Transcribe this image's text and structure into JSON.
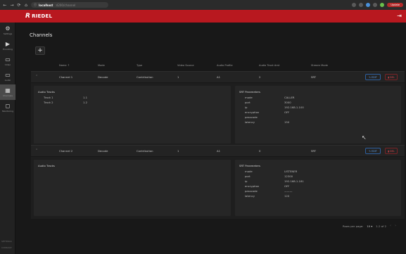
{
  "browser": {
    "nav": [
      "←",
      "→",
      "⟳",
      "⌂"
    ],
    "url_host": "localhost",
    "url_path": ":4200/channel",
    "profile": "Update"
  },
  "app": {
    "brand": "RIEDEL",
    "brand_mark": "R"
  },
  "sidebar": {
    "items": [
      {
        "icon": "⚙",
        "label": "Settings",
        "name": "settings"
      },
      {
        "icon": "▶",
        "label": "Encoding",
        "name": "encoding"
      },
      {
        "icon": "▭",
        "label": "Video",
        "name": "video"
      },
      {
        "icon": "▭",
        "label": "Audio",
        "name": "audio"
      },
      {
        "icon": "▦",
        "label": "Channels",
        "name": "channels"
      },
      {
        "icon": "◻",
        "label": "Monitoring",
        "name": "monitoring"
      }
    ],
    "footer": [
      "SETTINGS",
      "CONSOLE"
    ]
  },
  "page": {
    "title": "Channels",
    "add_label": "+"
  },
  "table": {
    "headers": [
      "Name ↑",
      "Mode",
      "Type",
      "Video Source",
      "Audio Profile",
      "Audio Track Amt",
      "Stream Mode"
    ],
    "edit_label": "EDIT",
    "delete_label": "DEL",
    "rows": [
      {
        "name": "Channel 1",
        "mode": "Decode",
        "type": "Contribution",
        "video_source": "1",
        "audio_profile": "A1",
        "audio_track_amt": "2",
        "stream_mode": "SRT",
        "audio_title": "Audio Tracks",
        "tracks": [
          {
            "label": "Track 1",
            "value": "1.1"
          },
          {
            "label": "Track 2",
            "value": "1.2"
          }
        ],
        "srt_title": "SRT Parameters",
        "srt": [
          {
            "key": "mode",
            "value": "CALLER"
          },
          {
            "key": "port",
            "value": "3000"
          },
          {
            "key": "ip",
            "value": "192.168.1.100"
          },
          {
            "key": "encryption",
            "value": "OFF"
          },
          {
            "key": "passcode",
            "value": ""
          },
          {
            "key": "latency",
            "value": "150"
          }
        ]
      },
      {
        "name": "Channel 2",
        "mode": "Decode",
        "type": "Contribution",
        "video_source": "1",
        "audio_profile": "A1",
        "audio_track_amt": "0",
        "stream_mode": "SRT",
        "audio_title": "Audio Tracks",
        "tracks": [],
        "srt_title": "SRT Parameters",
        "srt": [
          {
            "key": "mode",
            "value": "LISTENER"
          },
          {
            "key": "port",
            "value": "12300"
          },
          {
            "key": "ip",
            "value": "192.168.1.181"
          },
          {
            "key": "encryption",
            "value": "OFF"
          },
          {
            "key": "passcode",
            "value": "———"
          },
          {
            "key": "latency",
            "value": "120"
          }
        ]
      }
    ]
  },
  "pagination": {
    "rows_label": "Rows per page:",
    "rows_value": "10 ▾",
    "range": "1-2 of 2",
    "prev": "‹",
    "next": "›"
  }
}
